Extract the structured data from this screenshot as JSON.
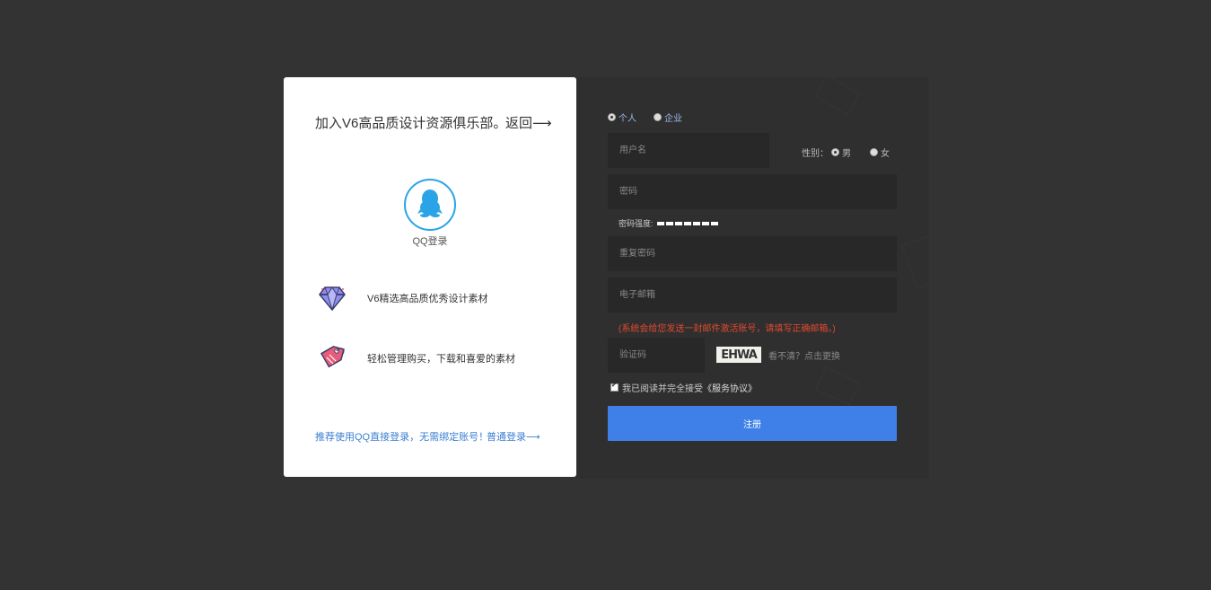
{
  "left": {
    "title": "加入V6高品质设计资源俱乐部。",
    "back_label": "返回⟶",
    "qq_label": "QQ登录",
    "features": [
      {
        "icon": "diamond-icon",
        "text": "V6精选高品质优秀设计素材"
      },
      {
        "icon": "tag-icon",
        "text": "轻松管理购买，下载和喜爱的素材"
      }
    ],
    "bottom_tip": "推荐使用QQ直接登录，无需绑定账号！",
    "normal_login": "普通登录⟶"
  },
  "form": {
    "account_types": [
      {
        "label": "个人",
        "selected": true
      },
      {
        "label": "企业",
        "selected": false
      }
    ],
    "username_placeholder": "用户名",
    "gender_label": "性别：",
    "genders": [
      {
        "label": "男",
        "selected": true
      },
      {
        "label": "女",
        "selected": false
      }
    ],
    "password_placeholder": "密码",
    "strength_label": "密码强度:",
    "repeat_password_placeholder": "重复密码",
    "email_placeholder": "电子邮箱",
    "email_warning": "(系统会给您发送一封邮件激活账号，请填写正确邮箱。)",
    "captcha_placeholder": "验证码",
    "captcha_text": "EHWA",
    "captcha_refresh": "看不清？点击更换",
    "agree_text": "我已阅读并完全接受",
    "service_link": "《服务协议》",
    "register_label": "注册"
  },
  "colors": {
    "background": "#333333",
    "accent": "#3f80e8",
    "link": "#3b7fd1",
    "warning": "#e0492f",
    "qq": "#2aa4e6"
  }
}
